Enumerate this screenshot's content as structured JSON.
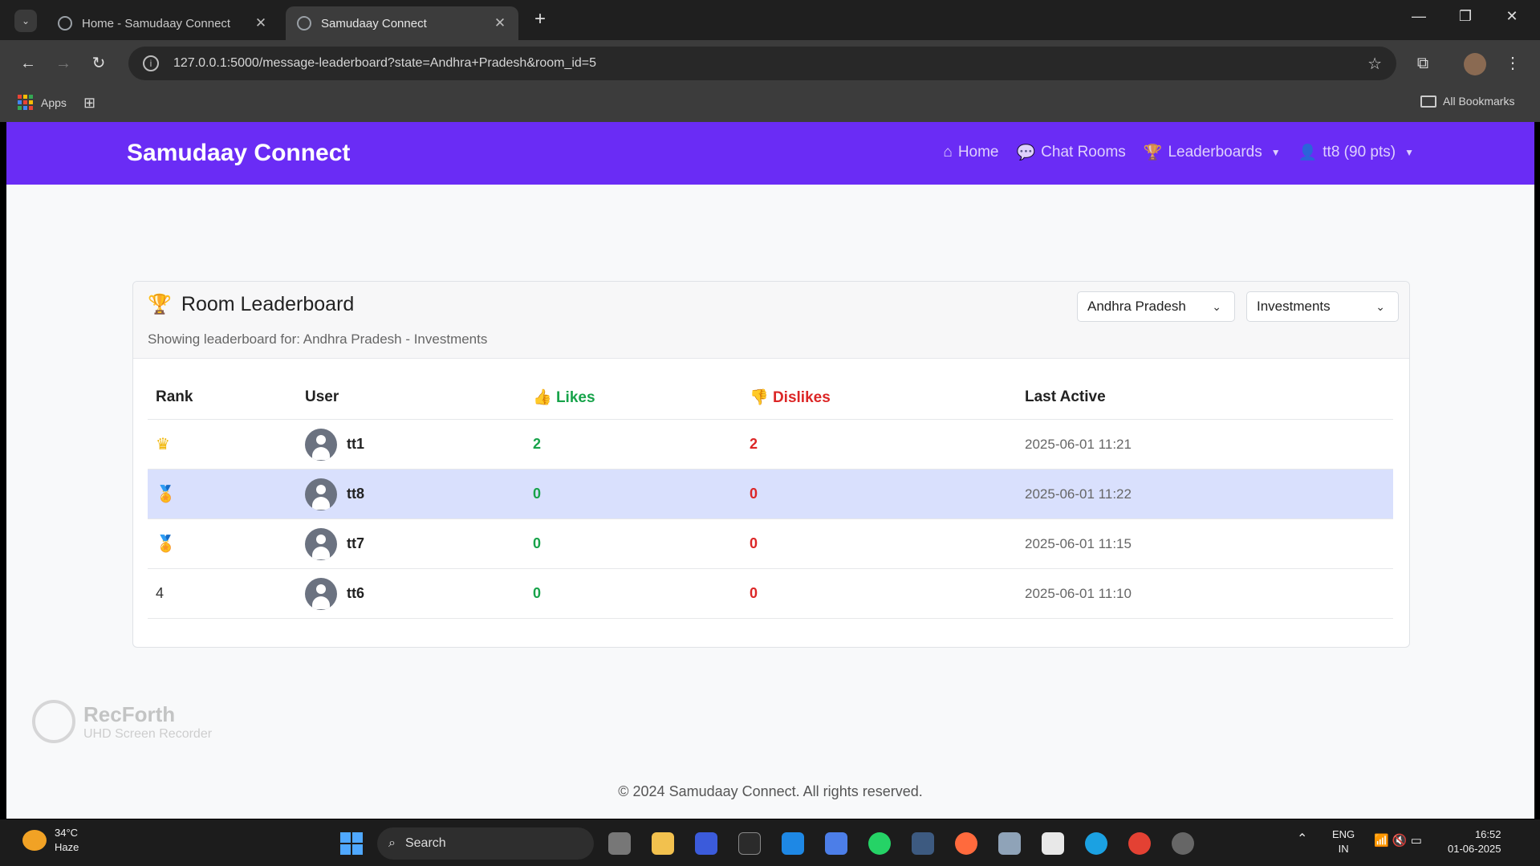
{
  "browser": {
    "tabs": [
      {
        "title": "Home - Samudaay Connect",
        "active": false
      },
      {
        "title": "Samudaay Connect",
        "active": true
      }
    ],
    "url": "127.0.0.1:5000/message-leaderboard?state=Andhra+Pradesh&room_id=5",
    "bookmarks": {
      "apps_label": "Apps",
      "all_bookmarks_label": "All Bookmarks"
    }
  },
  "navbar": {
    "brand": "Samudaay Connect",
    "links": {
      "home": "Home",
      "chat_rooms": "Chat Rooms",
      "leaderboards": "Leaderboards",
      "user": "tt8 (90 pts)"
    }
  },
  "leaderboard": {
    "title": "Room Leaderboard",
    "subtitle": "Showing leaderboard for: Andhra Pradesh - Investments",
    "state_select": "Andhra Pradesh",
    "room_select": "Investments",
    "columns": {
      "rank": "Rank",
      "user": "User",
      "likes": "Likes",
      "dislikes": "Dislikes",
      "last_active": "Last Active"
    },
    "rows": [
      {
        "rank": "",
        "rank_icon": "crown-icon",
        "user": "tt1",
        "likes": "2",
        "dislikes": "2",
        "last_active": "2025-06-01 11:21",
        "highlight": false
      },
      {
        "rank": "",
        "rank_icon": "silver-medal-icon",
        "user": "tt8",
        "likes": "0",
        "dislikes": "0",
        "last_active": "2025-06-01 11:22",
        "highlight": true
      },
      {
        "rank": "",
        "rank_icon": "bronze-medal-icon",
        "user": "tt7",
        "likes": "0",
        "dislikes": "0",
        "last_active": "2025-06-01 11:15",
        "highlight": false
      },
      {
        "rank": "4",
        "rank_icon": "",
        "user": "tt6",
        "likes": "0",
        "dislikes": "0",
        "last_active": "2025-06-01 11:10",
        "highlight": false
      }
    ],
    "colors": {
      "likes": "#17a34a",
      "dislikes": "#dc2626",
      "highlight_row": "#d9e0fd",
      "navbar": "#6a2cf5"
    }
  },
  "watermark": {
    "title": "RecForth",
    "subtitle": "UHD Screen Recorder"
  },
  "footer": "© 2024 Samudaay Connect. All rights reserved.",
  "taskbar": {
    "weather_temp": "34°C",
    "weather_desc": "Haze",
    "search_label": "Search",
    "lang_top": "ENG",
    "lang_bottom": "IN",
    "time": "16:52",
    "date": "01-06-2025"
  }
}
